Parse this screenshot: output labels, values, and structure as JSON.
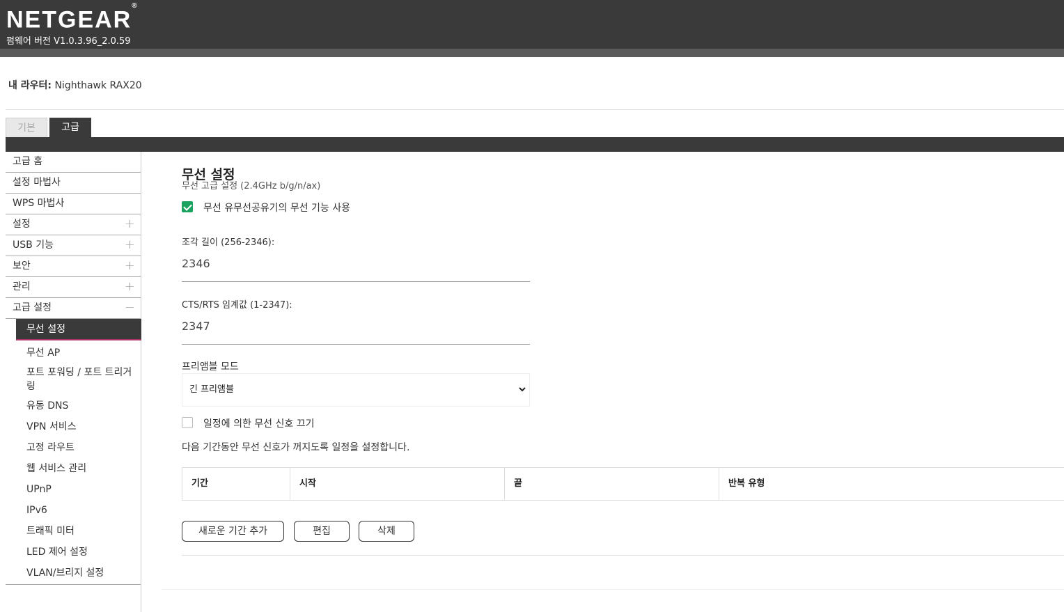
{
  "header": {
    "logo": "NETGEAR",
    "logo_mark": "®",
    "firmware": "펌웨어 버전 V1.0.3.96_2.0.59"
  },
  "router": {
    "label": "내 라우터:",
    "name": "Nighthawk RAX20"
  },
  "tabs": {
    "basic": "기본",
    "advanced": "고급"
  },
  "sidebar": {
    "items": [
      {
        "label": "고급 홈",
        "expander": ""
      },
      {
        "label": "설정 마법사",
        "expander": ""
      },
      {
        "label": "WPS 마법사",
        "expander": ""
      },
      {
        "label": "설정",
        "expander": "+"
      },
      {
        "label": "USB 기능",
        "expander": "+"
      },
      {
        "label": "보안",
        "expander": "+"
      },
      {
        "label": "관리",
        "expander": "+"
      },
      {
        "label": "고급 설정",
        "expander": "−"
      }
    ],
    "subitems": [
      "무선 설정",
      "무선 AP",
      "포트 포워딩 / 포트 트리거링",
      "유동 DNS",
      "VPN 서비스",
      "고정 라우트",
      "웹 서비스 관리",
      "UPnP",
      "IPv6",
      "트래픽 미터",
      "LED 제어 설정",
      "VLAN/브리지 설정"
    ]
  },
  "main": {
    "title": "무선 설정",
    "subtitle": "무선 고급 설정 (2.4GHz b/g/n/ax)",
    "enable_wireless_label": "무선 유무선공유기의 무선 기능 사용",
    "enable_wireless_checked": true,
    "frag_label": "조각 길이 (256-2346):",
    "frag_value": "2346",
    "cts_label": "CTS/RTS 임계값 (1-2347):",
    "cts_value": "2347",
    "preamble_label": "프리앰블 모드",
    "preamble_value": "긴 프리앰블",
    "schedule_label": "일정에 의한 무선 신호 끄기",
    "schedule_checked": false,
    "schedule_desc": "다음 기간동안 무선 신호가 꺼지도록 일정을 설정합니다.",
    "table_headers": [
      "기간",
      "시작",
      "끝",
      "반복 유형"
    ],
    "buttons": {
      "add": "새로운 기간 추가",
      "edit": "편집",
      "delete": "삭제"
    }
  },
  "colors": {
    "header_bg": "#3a3a3a",
    "check_green": "#1aa260",
    "active_underline": "#b0306a"
  }
}
